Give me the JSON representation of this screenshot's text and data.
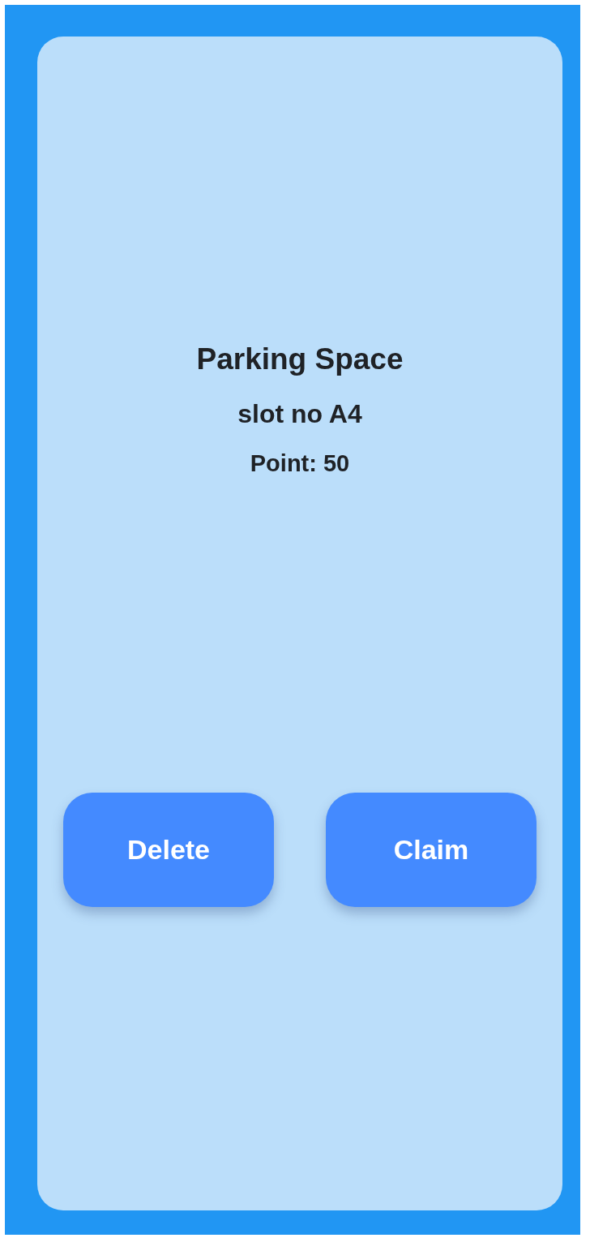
{
  "card": {
    "title": "Parking Space",
    "slot": "slot no A4",
    "points": "Point: 50"
  },
  "buttons": [
    {
      "label": "Delete"
    },
    {
      "label": "Claim"
    }
  ]
}
